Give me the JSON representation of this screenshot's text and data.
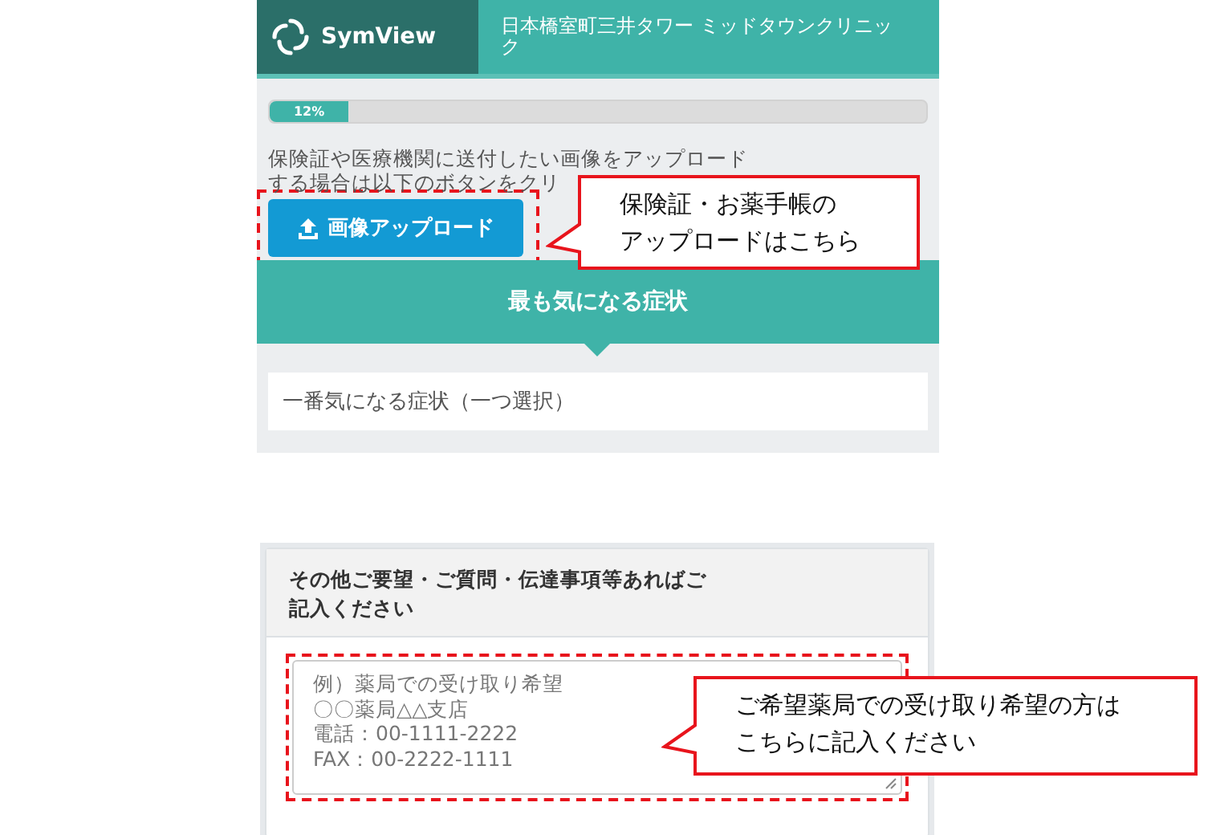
{
  "header": {
    "logo": "SymView",
    "clinic": "日本橋室町三井タワー ミッドタウンクリニック"
  },
  "progress": {
    "level": 0.12,
    "label": "12%"
  },
  "upload_text": [
    "保険証や医療機関に送付したい画像をアップロード",
    "する場合は以下のボタンをクリ"
  ],
  "upload_button": "画像アップロード",
  "section_title": "最も気になる症状",
  "symptom_select": {
    "placeholder": "一番気になる症状（一つ選択）"
  },
  "comments": {
    "title": "その他ご要望・ご質問・伝達事項等あればご記入ください",
    "placeholder": [
      "例）薬局での受け取り希望",
      "〇〇薬局△△支店",
      "電話：00-1111-2222",
      "FAX：00-2222-1111"
    ]
  },
  "callouts": [
    {
      "lines": [
        "保険証・お薬手帳の",
        "アップロードはこちら"
      ]
    },
    {
      "lines": [
        "ご希望薬局での受け取り希望の方は",
        "こちらに記入ください"
      ]
    }
  ]
}
